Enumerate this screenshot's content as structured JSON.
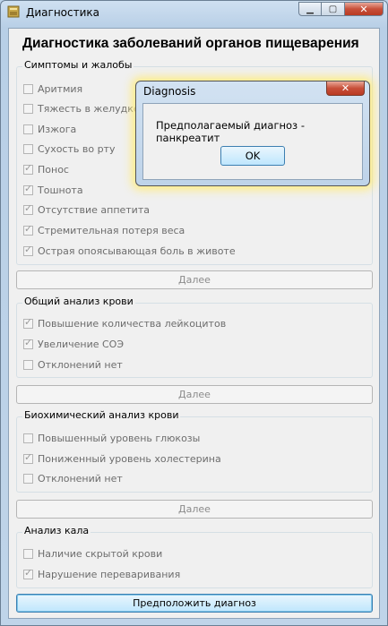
{
  "window": {
    "title": "Диагностика"
  },
  "heading": "Диагностика заболеваний органов пищеварения",
  "groups": {
    "symptoms": {
      "title": "Симптомы и жалобы",
      "items": [
        {
          "label": "Аритмия",
          "checked": false
        },
        {
          "label": "Тяжесть в желудке",
          "checked": false
        },
        {
          "label": "Изжога",
          "checked": false
        },
        {
          "label": "Сухость во рту",
          "checked": false
        },
        {
          "label": "Понос",
          "checked": true
        },
        {
          "label": "Тошнота",
          "checked": true
        },
        {
          "label": "Отсутствие аппетита",
          "checked": true
        },
        {
          "label": "Стремительная потеря веса",
          "checked": true
        },
        {
          "label": "Острая опоясывающая боль в животе",
          "checked": true
        }
      ]
    },
    "blood": {
      "title": "Общий анализ крови",
      "items": [
        {
          "label": "Повышение количества лейкоцитов",
          "checked": true
        },
        {
          "label": "Увеличение СОЭ",
          "checked": true
        },
        {
          "label": "Отклонений нет",
          "checked": false
        }
      ]
    },
    "biochem": {
      "title": "Биохимический анализ крови",
      "items": [
        {
          "label": "Повышенный уровень глюкозы",
          "checked": false
        },
        {
          "label": "Пониженный уровень холестерина",
          "checked": true
        },
        {
          "label": "Отклонений нет",
          "checked": false
        }
      ]
    },
    "stool": {
      "title": "Анализ кала",
      "items": [
        {
          "label": "Наличие скрытой крови",
          "checked": false
        },
        {
          "label": "Нарушение переваривания",
          "checked": true
        }
      ]
    }
  },
  "buttons": {
    "next": "Далее",
    "diagnose": "Предположить диагноз"
  },
  "dialog": {
    "title": "Diagnosis",
    "message": "Предполагаемый диагноз - панкреатит",
    "ok": "OK"
  }
}
